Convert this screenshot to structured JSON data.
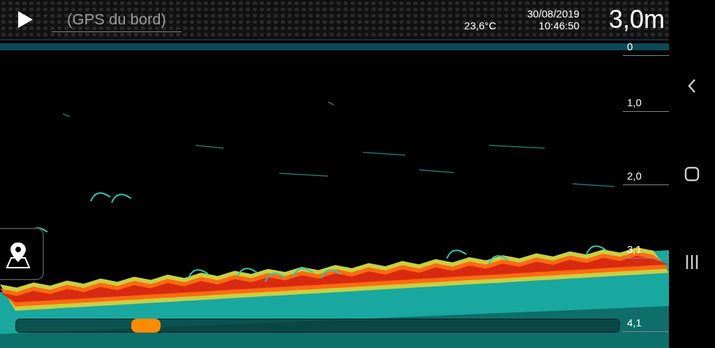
{
  "header": {
    "gps_placeholder": "(GPS du bord)",
    "temperature": "23,6°C",
    "date": "30/08/2019",
    "time": "10:46:50",
    "depth": "3,0m"
  },
  "depth_scale": [
    "0",
    "1,0",
    "2,0",
    "3,1",
    "4,1"
  ],
  "history_slider": {
    "level": 0.2
  }
}
